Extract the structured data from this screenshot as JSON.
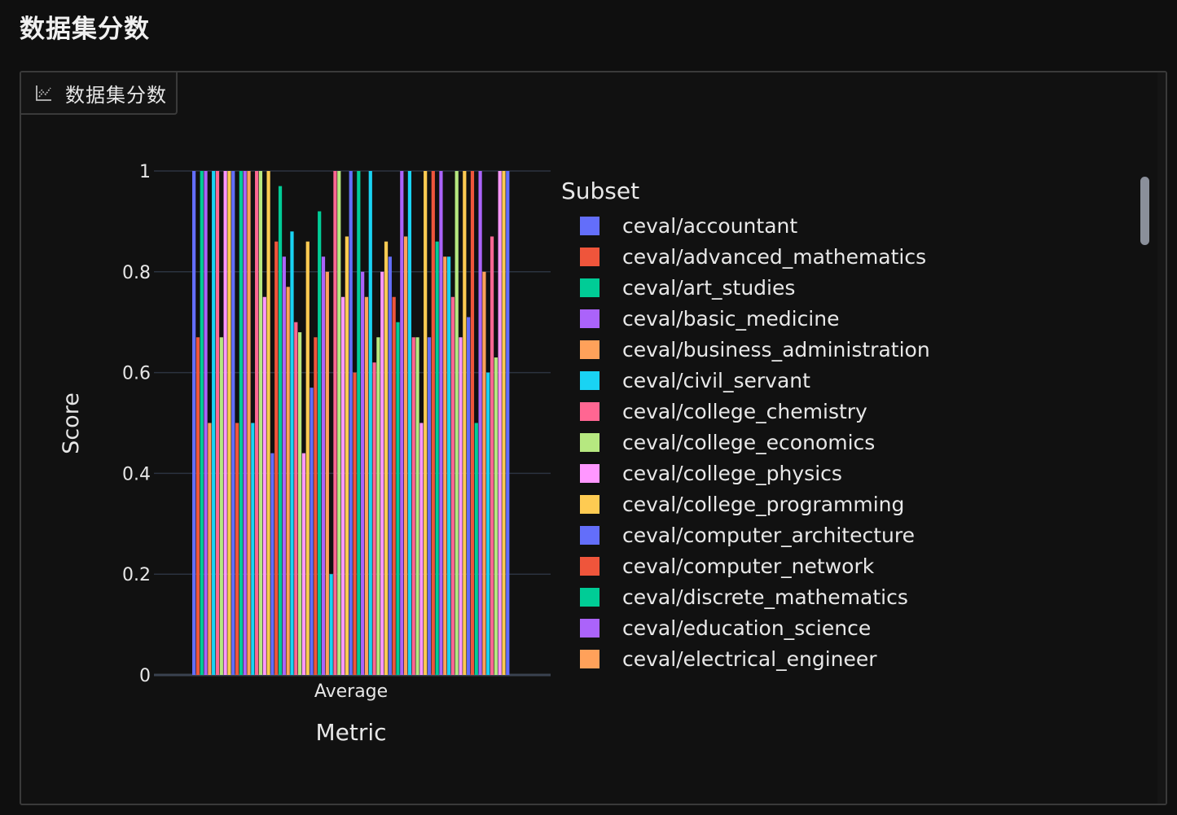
{
  "page_title": "数据集分数",
  "tab": {
    "label": "数据集分数",
    "icon": "chart-line-icon"
  },
  "legend": {
    "title": "Subset",
    "items": [
      {
        "label": "ceval/accountant",
        "color": "#636efa"
      },
      {
        "label": "ceval/advanced_mathematics",
        "color": "#ef553b"
      },
      {
        "label": "ceval/art_studies",
        "color": "#00cc96"
      },
      {
        "label": "ceval/basic_medicine",
        "color": "#ab63fa"
      },
      {
        "label": "ceval/business_administration",
        "color": "#ffa15a"
      },
      {
        "label": "ceval/civil_servant",
        "color": "#19d3f3"
      },
      {
        "label": "ceval/college_chemistry",
        "color": "#ff6692"
      },
      {
        "label": "ceval/college_economics",
        "color": "#b6e880"
      },
      {
        "label": "ceval/college_physics",
        "color": "#ff97ff"
      },
      {
        "label": "ceval/college_programming",
        "color": "#fecb52"
      },
      {
        "label": "ceval/computer_architecture",
        "color": "#636efa"
      },
      {
        "label": "ceval/computer_network",
        "color": "#ef553b"
      },
      {
        "label": "ceval/discrete_mathematics",
        "color": "#00cc96"
      },
      {
        "label": "ceval/education_science",
        "color": "#ab63fa"
      },
      {
        "label": "ceval/electrical_engineer",
        "color": "#ffa15a"
      }
    ]
  },
  "chart_data": {
    "type": "bar",
    "xlabel": "Metric",
    "ylabel": "Score",
    "categories": [
      "Average"
    ],
    "ylim": [
      0,
      1
    ],
    "yticks": [
      "0",
      "0.2",
      "0.4",
      "0.6",
      "0.8",
      "1"
    ],
    "grid": true,
    "legend_placement": "right",
    "palette": [
      "#636efa",
      "#ef553b",
      "#00cc96",
      "#ab63fa",
      "#ffa15a",
      "#19d3f3",
      "#ff6692",
      "#b6e880",
      "#ff97ff",
      "#fecb52"
    ],
    "values": [
      1,
      0.67,
      1,
      1,
      0.5,
      1,
      1,
      0.67,
      1,
      1,
      1,
      0.5,
      1,
      1,
      1,
      0.5,
      1,
      1,
      0.75,
      1,
      0.44,
      0.86,
      0.97,
      0.83,
      0.77,
      0.88,
      0.7,
      0.68,
      0.44,
      0.86,
      0.57,
      0.67,
      0.92,
      0.83,
      0.8,
      0.2,
      1,
      1,
      0.75,
      0.87,
      1,
      0.6,
      1,
      0.8,
      0.75,
      1,
      0.62,
      0.67,
      0.8,
      0.86,
      0.83,
      0.75,
      0.7,
      1,
      0.87,
      1,
      0.67,
      0.67,
      0.5,
      1,
      0.67,
      1,
      0.86,
      1,
      0.83,
      0.83,
      0.75,
      1,
      0.67,
      1,
      0.71,
      1,
      0.5,
      1,
      0.8,
      0.6,
      0.87,
      0.63,
      1,
      1,
      1
    ]
  }
}
